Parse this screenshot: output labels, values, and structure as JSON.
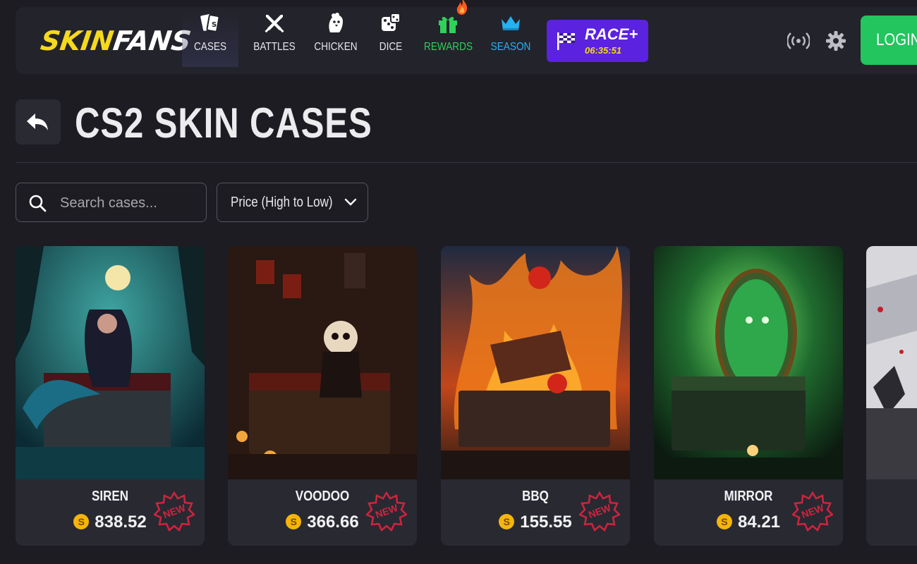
{
  "brand": {
    "part1": "SKIN",
    "part2": "FANS"
  },
  "nav": [
    {
      "id": "cases",
      "label": "CASES",
      "icon": "cards-icon"
    },
    {
      "id": "battles",
      "label": "BATTLES",
      "icon": "crossed-swords-icon"
    },
    {
      "id": "chicken",
      "label": "CHICKEN",
      "icon": "chicken-icon"
    },
    {
      "id": "dice",
      "label": "DICE",
      "icon": "dice-icon"
    },
    {
      "id": "rewards",
      "label": "REWARDS",
      "icon": "gift-icon"
    },
    {
      "id": "season",
      "label": "SEASON",
      "icon": "crown-icon"
    }
  ],
  "race": {
    "title": "RACE+",
    "timer": "06:35:51"
  },
  "login_label": "LOGIN",
  "page_title": "CS2 SKIN CASES",
  "search": {
    "placeholder": "Search cases..."
  },
  "sort": {
    "value": "Price (High to Low)"
  },
  "cases": [
    {
      "name": "SIREN",
      "price": "838.52",
      "badge": "NEW"
    },
    {
      "name": "VOODOO",
      "price": "366.66",
      "badge": "NEW"
    },
    {
      "name": "BBQ",
      "price": "155.55",
      "badge": "NEW"
    },
    {
      "name": "MIRROR",
      "price": "84.21",
      "badge": "NEW"
    }
  ],
  "colors": {
    "accent_green": "#22c55e",
    "rewards": "#2fd15a",
    "season": "#27b1f0",
    "race": "#5b22e0",
    "logo_yellow": "#f5d91c",
    "badge_red": "#d0243e"
  }
}
